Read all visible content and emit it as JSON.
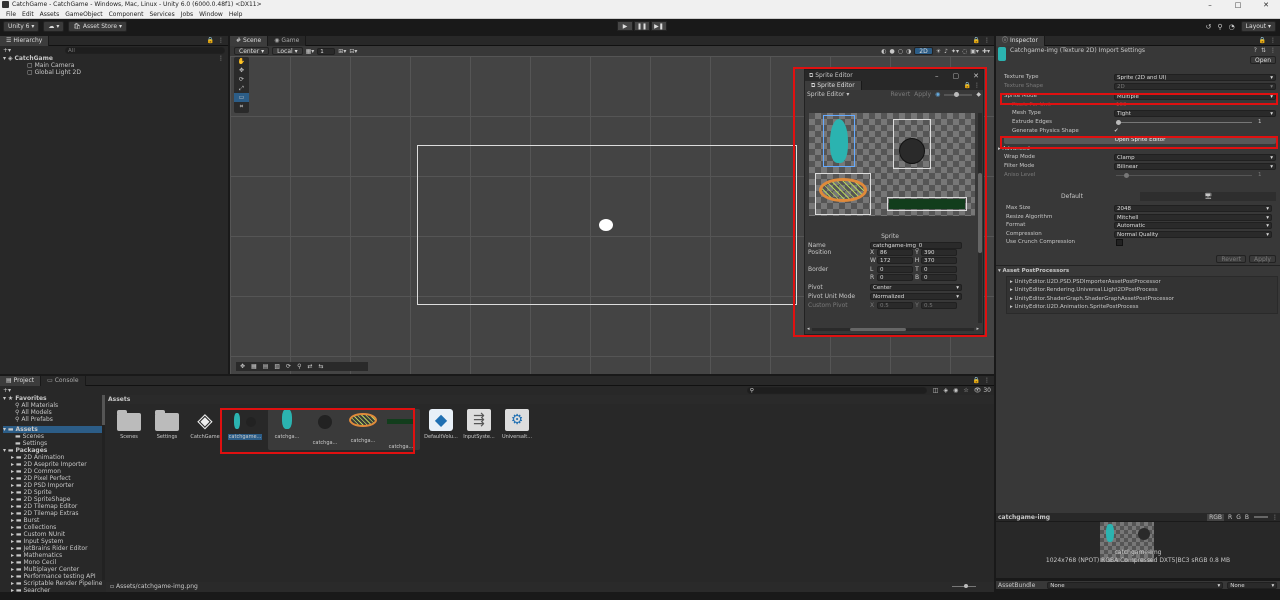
{
  "window": {
    "title": "CatchGame - CatchGame - Windows, Mac, Linux - Unity 6.0 (6000.0.48f1) <DX11>",
    "controls": [
      "–",
      "□",
      "✕"
    ]
  },
  "menu": [
    "File",
    "Edit",
    "Assets",
    "GameObject",
    "Component",
    "Services",
    "Jobs",
    "Window",
    "Help"
  ],
  "toolbar": {
    "account": "Unity 6",
    "asset_store": "Asset Store",
    "layout": "Layout"
  },
  "hierarchy": {
    "tab": "Hierarchy",
    "search_placeholder": "All",
    "scene": "CatchGame",
    "items": [
      "Main Camera",
      "Global Light 2D"
    ]
  },
  "scene": {
    "tabs": [
      "Scene",
      "Game"
    ],
    "pivot": "Center",
    "space": "Local",
    "grid_value": "1",
    "mode_2d": "2D"
  },
  "sprite_editor": {
    "title": "Sprite Editor",
    "tab": "Sprite Editor",
    "mode_dropdown": "Sprite Editor",
    "revert": "Revert",
    "apply": "Apply",
    "panel_title": "Sprite",
    "name_label": "Name",
    "name_value": "catchgame-img_0",
    "position_label": "Position",
    "pos_x": "86",
    "pos_y": "390",
    "pos_w": "172",
    "pos_h": "370",
    "border_label": "Border",
    "border_l": "0",
    "border_t": "0",
    "border_r": "0",
    "border_b": "0",
    "pivot_label": "Pivot",
    "pivot_value": "Center",
    "pivot_unit_label": "Pivot Unit Mode",
    "pivot_unit_value": "Normalized",
    "custom_pivot_label": "Custom Pivot",
    "custom_x": "0.5",
    "custom_y": "0.5",
    "axis": {
      "x": "X",
      "y": "Y",
      "w": "W",
      "h": "H",
      "l": "L",
      "t": "T",
      "r": "R",
      "b": "B"
    }
  },
  "inspector": {
    "tab": "Inspector",
    "title": "Catchgame-img (Texture 2D) Import Settings",
    "open": "Open",
    "texture_type_label": "Texture Type",
    "texture_type": "Sprite (2D and UI)",
    "texture_shape_label": "Texture Shape",
    "texture_shape": "2D",
    "sprite_mode_label": "Sprite Mode",
    "sprite_mode": "Multiple",
    "ppu_label": "Pixels Per Unit",
    "ppu": "100",
    "mesh_type_label": "Mesh Type",
    "mesh_type": "Tight",
    "extrude_label": "Extrude Edges",
    "extrude": "1",
    "physics_label": "Generate Physics Shape",
    "open_sprite_editor": "Open Sprite Editor",
    "advanced": "Advanced",
    "wrap_label": "Wrap Mode",
    "wrap": "Clamp",
    "filter_label": "Filter Mode",
    "filter": "Bilinear",
    "aniso_label": "Aniso Level",
    "aniso": "1",
    "platform_tab": "Default",
    "max_size_label": "Max Size",
    "max_size": "2048",
    "resize_label": "Resize Algorithm",
    "resize": "Mitchell",
    "format_label": "Format",
    "format": "Automatic",
    "compression_label": "Compression",
    "compression": "Normal Quality",
    "crunch_label": "Use Crunch Compression",
    "revert": "Revert",
    "apply": "Apply",
    "postprocessors_title": "Asset PostProcessors",
    "postprocessors": [
      "UnityEditor.U2D.PSD.PSDImporterAssetPostProcessor",
      "UnityEditor.Rendering.Universal.Light2DPostProcess",
      "UnityEditor.ShaderGraph.ShaderGraphAssetPostProcessor",
      "UnityEditor.U2D.Animation.SpritePostProcess"
    ],
    "preview_name": "catchgame-img",
    "preview_channels": [
      "RGB",
      "R",
      "G",
      "B"
    ],
    "preview_caption": "catchgame-img",
    "preview_info": "1024x768 (NPOT)  RGBA Compressed DXT5|BC3 sRGB  0.8 MB",
    "assetbundle_label": "AssetBundle",
    "assetbundle_value": "None",
    "assetbundle_variant": "None"
  },
  "project": {
    "tabs": [
      "Project",
      "Console"
    ],
    "favorites_title": "Favorites",
    "favorites": [
      "All Materials",
      "All Models",
      "All Prefabs"
    ],
    "assets_title": "Assets",
    "asset_folders": [
      "Scenes",
      "Settings"
    ],
    "packages_title": "Packages",
    "packages": [
      "2D Animation",
      "2D Aseprite Importer",
      "2D Common",
      "2D Pixel Perfect",
      "2D PSD Importer",
      "2D Sprite",
      "2D SpriteShape",
      "2D Tilemap Editor",
      "2D Tilemap Extras",
      "Burst",
      "Collections",
      "Custom NUnit",
      "Input System",
      "JetBrains Rider Editor",
      "Mathematics",
      "Mono Cecil",
      "Multiplayer Center",
      "Performance testing API",
      "Scriptable Render Pipeline",
      "Searcher"
    ],
    "breadcrumb": "Assets",
    "count": "30",
    "items": [
      "Scenes",
      "Settings",
      "CatchGame",
      "catchgame...",
      "catchga...",
      "catchga...",
      "catchga...",
      "catchga...",
      "DefaultVolu...",
      "InputSyste...",
      "Universalt..."
    ],
    "path": "Assets/catchgame-img.png"
  },
  "colors": {
    "highlight": "#e01010",
    "selection": "#2c5d87",
    "accent_button": "#585858"
  }
}
